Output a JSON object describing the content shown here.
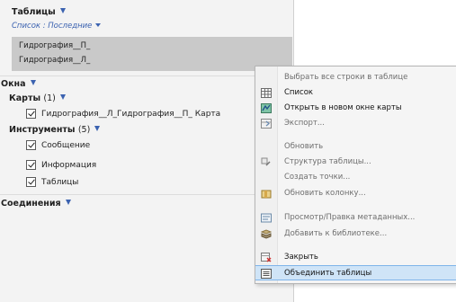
{
  "tables_section": {
    "title": "Таблицы",
    "list_label": "Список : Последние"
  },
  "tables_list": [
    "Гидрография__П_",
    "Гидрография__Л_"
  ],
  "windows_section": {
    "title": "Окна",
    "maps_label": "Карты",
    "maps_count": "(1)",
    "map_item": "Гидрография__Л_Гидрография__П_ Карта",
    "tools_label": "Инструменты",
    "tools_count": "(5)",
    "tools": [
      "Сообщение",
      "Информация",
      "Таблицы"
    ]
  },
  "connections_section": {
    "title": "Соединения"
  },
  "context_menu": {
    "items": [
      {
        "label": "Выбрать все строки в таблице",
        "icon": "none",
        "enabled": false
      },
      {
        "label": "Список",
        "icon": "table-icon",
        "enabled": true
      },
      {
        "label": "Открыть в новом окне карты",
        "icon": "map-icon",
        "enabled": true
      },
      {
        "label": "Экспорт...",
        "icon": "export-icon",
        "enabled": false
      },
      {
        "label": "Обновить",
        "icon": "none",
        "enabled": false
      },
      {
        "label": "Структура таблицы...",
        "icon": "structure-icon",
        "enabled": false
      },
      {
        "label": "Создать точки...",
        "icon": "none",
        "enabled": false
      },
      {
        "label": "Обновить колонку...",
        "icon": "update-column-icon",
        "enabled": false
      },
      {
        "label": "Просмотр/Правка метаданных...",
        "icon": "metadata-icon",
        "enabled": false
      },
      {
        "label": "Добавить к библиотеке...",
        "icon": "library-icon",
        "enabled": false
      },
      {
        "label": "Закрыть",
        "icon": "close-table-icon",
        "enabled": true
      },
      {
        "label": "Объединить таблицы",
        "icon": "merge-tables-icon",
        "enabled": true,
        "selected": true
      }
    ]
  },
  "colors": {
    "accent": "#3b62b0",
    "selection": "#cfe4f7",
    "list_background": "#c9c9c9"
  }
}
